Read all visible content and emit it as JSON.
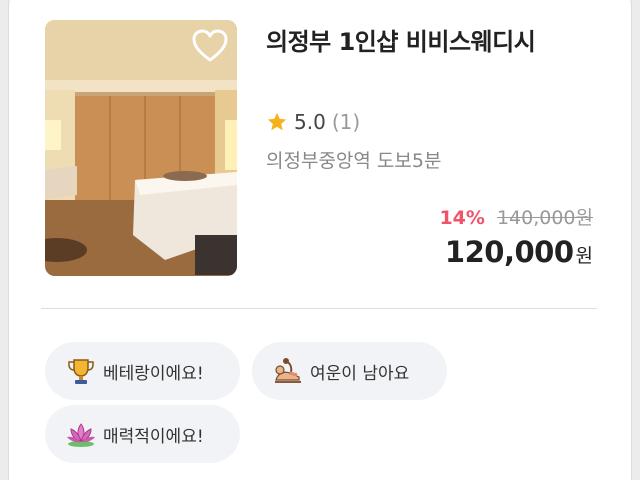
{
  "listing": {
    "title": "의정부 1인샵 비비스웨디시",
    "rating": "5.0",
    "review_count": "(1)",
    "location": "의정부중앙역 도보5분",
    "discount": "14%",
    "original_price": "140,000원",
    "price": "120,000",
    "currency": "원",
    "favorite": false
  },
  "tags": [
    {
      "label": "베테랑이에요!",
      "icon": "trophy-icon"
    },
    {
      "label": "여운이 남아요",
      "icon": "massage-icon"
    },
    {
      "label": "매력적이에요!",
      "icon": "lotus-icon"
    }
  ],
  "colors": {
    "discount": "#f0546a",
    "star": "#f5b21b",
    "tag_background": "#f2f3f6"
  }
}
